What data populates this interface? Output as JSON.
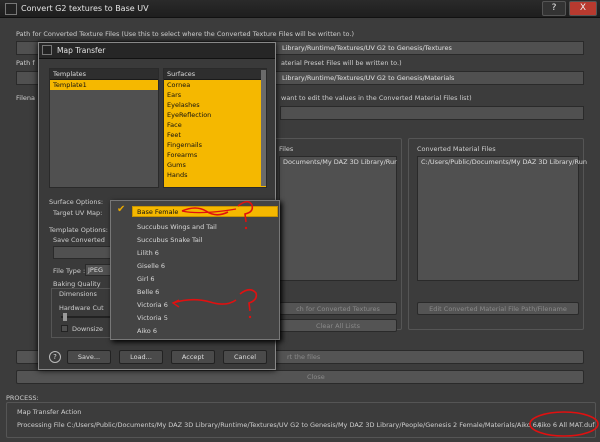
{
  "window": {
    "title": "Convert G2 textures to Base UV",
    "help": "?",
    "close": "X"
  },
  "main": {
    "path_texture_label": "Path for Converted Texture Files (Use this to select where the Converted Texture Files will be written to.)",
    "path_texture_value": "Library/Runtime/Textures/UV G2 to Genesis/Textures",
    "path_material_label": "Path f",
    "path_material_suffix": "aterial Preset Files will be written to.)",
    "path_material_value": "Library/Runtime/Textures/UV G2 to Genesis/Materials",
    "filename_label": "Filena",
    "filename_suffix": "want to edit the values in the Converted Material Files list)",
    "conv_files_label": "Files",
    "conv_files_value": "Documents/My DAZ 3D Library/Rur",
    "conv_material_label": "Converted Material Files",
    "conv_material_value": "C:/Users/Public/Documents/My DAZ 3D Library/Run",
    "search_btn": "ch for Converted Textures",
    "clear_btn": "Clear All Lists",
    "edit_btn": "Edit Converted Material File Path/Filename",
    "row1_btn": "rt the files",
    "row2_btn": "Close",
    "process_label": "PROCESS:",
    "map_action_label": "Map Transfer Action",
    "processing_text": "Processing File C:/Users/Public/Documents/My DAZ 3D Library/Runtime/Textures/UV G2 to Genesis/My DAZ 3D Library/People/Genesis 2 Female/Materials/Aiko 6 /",
    "processing_tail": "Aiko 6 All MAT.duf"
  },
  "dialog": {
    "title": "Map Transfer",
    "templates_header": "Templates",
    "templates": [
      "Template1"
    ],
    "surfaces_header": "Surfaces",
    "surfaces": [
      "Cornea",
      "Ears",
      "Eyelashes",
      "EyeReflection",
      "Face",
      "Feet",
      "Fingernails",
      "Forearms",
      "Gums",
      "Hands"
    ],
    "surface_options_label": "Surface Options:",
    "target_uv_label": "Target UV Map:",
    "template_options_label": "Template Options:",
    "save_converted_label": "Save Converted",
    "file_type_label": "File Type :",
    "file_type_value": "JPEG",
    "baking_quality_label": "Baking Quality",
    "dimensions_label": "Dimensions",
    "hardware_label": "Hardware Cut",
    "downsize_label": "Downsize",
    "buttons": {
      "help": "?",
      "save": "Save...",
      "load": "Load...",
      "accept": "Accept",
      "cancel": "Cancel"
    }
  },
  "uv_menu": {
    "selected": "Base Female",
    "items": [
      "Base Female",
      "Succubus Wings and Tail",
      "Succubus Snake Tail",
      "Lilith 6",
      "Giselle 6",
      "Girl 6",
      "Belle 6",
      "Victoria 6",
      "Victoria 5",
      "Aiko 6"
    ]
  },
  "colors": {
    "highlight": "#f5b800",
    "annotation": "#e01010"
  }
}
